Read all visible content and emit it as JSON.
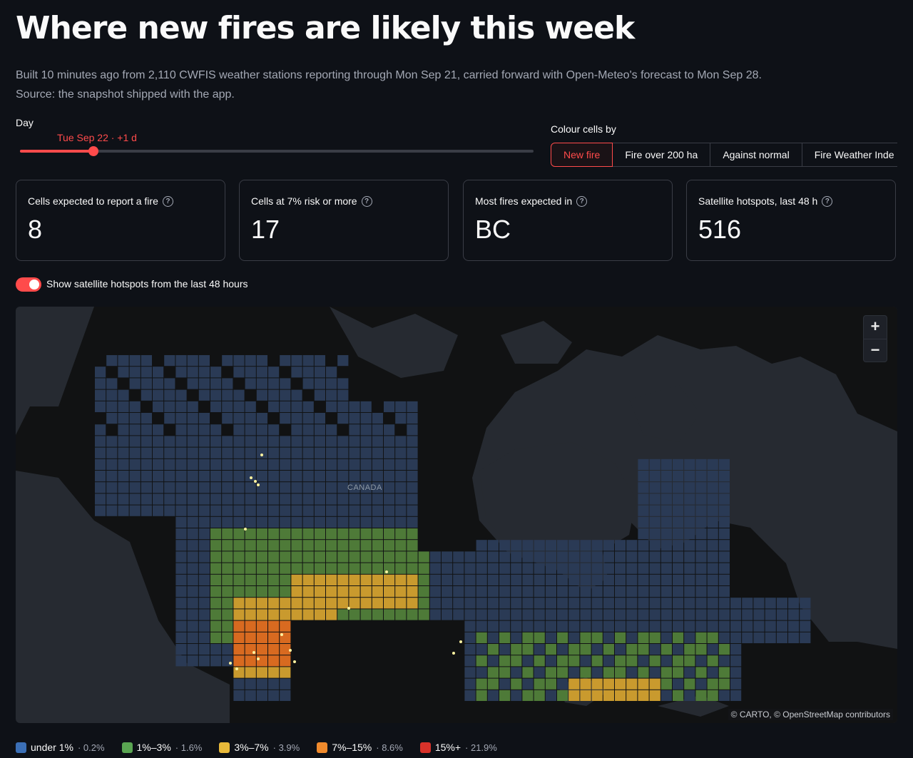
{
  "page": {
    "title": "Where new fires are likely this week",
    "subtitle_line1": "Built 10 minutes ago from 2,110 CWFIS weather stations reporting through Mon Sep 21, carried forward with Open-Meteo's forecast to Mon Sep 28.",
    "subtitle_line2": "Source: the snapshot shipped with the app."
  },
  "day_slider": {
    "label": "Day",
    "value_text": "Tue Sep 22 · +1 d",
    "fraction": 0.143
  },
  "colour_by": {
    "label": "Colour cells by",
    "options": [
      "New fire",
      "Fire over 200 ha",
      "Against normal",
      "Fire Weather Inde"
    ],
    "selected": "New fire"
  },
  "metrics": [
    {
      "label": "Cells expected to report a fire",
      "value": "8"
    },
    {
      "label": "Cells at 7% risk or more",
      "value": "17"
    },
    {
      "label": "Most fires expected in",
      "value": "BC"
    },
    {
      "label": "Satellite hotspots, last 48 h",
      "value": "516"
    }
  ],
  "toggle": {
    "label": "Show satellite hotspots from the last 48 hours",
    "on": true
  },
  "map": {
    "place_label": "CANADA",
    "zoom_in": "+",
    "zoom_out": "−",
    "attribution": "© CARTO, © OpenStreetMap contributors",
    "colors": {
      "water": "#262a31",
      "land": "#111213",
      "under1": "#2a3a55",
      "1to3": "#4e7a38",
      "3to7": "#c99a2e",
      "7to15": "#d86a20",
      "15plus": "#d8322a",
      "hotspot": "#fff3a0"
    }
  },
  "legend": [
    {
      "name": "under 1%",
      "pct": "· 0.2%",
      "color": "#3b6fb6"
    },
    {
      "name": "1%–3%",
      "pct": "· 1.6%",
      "color": "#5aa552"
    },
    {
      "name": "3%–7%",
      "pct": "· 3.9%",
      "color": "#e8b93a"
    },
    {
      "name": "7%–15%",
      "pct": "· 8.6%",
      "color": "#f08a2c"
    },
    {
      "name": "15%+",
      "pct": "· 21.9%",
      "color": "#d8322a"
    }
  ]
}
